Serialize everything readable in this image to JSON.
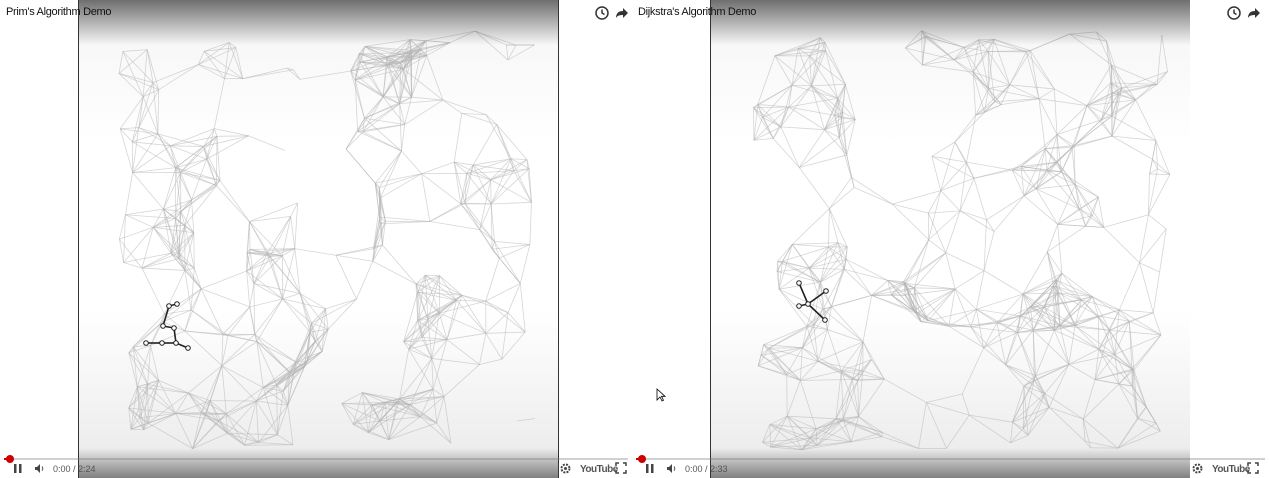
{
  "players": {
    "left": {
      "title": "Prim's Algorithm Demo",
      "time": "0:00 / 2:24",
      "progress": 0.01,
      "logo": "YouTube"
    },
    "right": {
      "title": "Dijkstra's Algorithm Demo",
      "time": "0:00 / 2:33",
      "progress": 0.01,
      "logo": "YouTube"
    }
  },
  "icons": {
    "watch_later": "clock-icon",
    "share": "share-arrow-icon",
    "pause": "pause-icon",
    "volume": "volume-icon",
    "settings": "gear-icon",
    "fullscreen": "fullscreen-icon"
  },
  "colors": {
    "progress": "#cc0000",
    "graph_edge": "#b4b4b4",
    "tree_edge": "#222222"
  }
}
